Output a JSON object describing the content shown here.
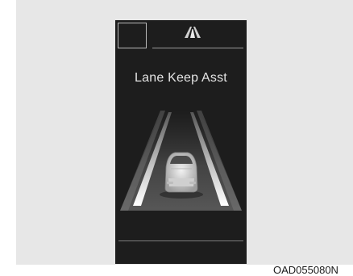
{
  "display": {
    "title": "Lane Keep Asst",
    "top_icon": "lane-assist-icon",
    "scene": "car-centered-in-lane-illustration"
  },
  "caption": {
    "figure_code": "OAD055080N"
  },
  "colors": {
    "screen_background": "#1d1d1d",
    "backdrop": "#e7e7e7",
    "lane_lines": "#ffffff",
    "car_body": "#d8d8d8"
  }
}
